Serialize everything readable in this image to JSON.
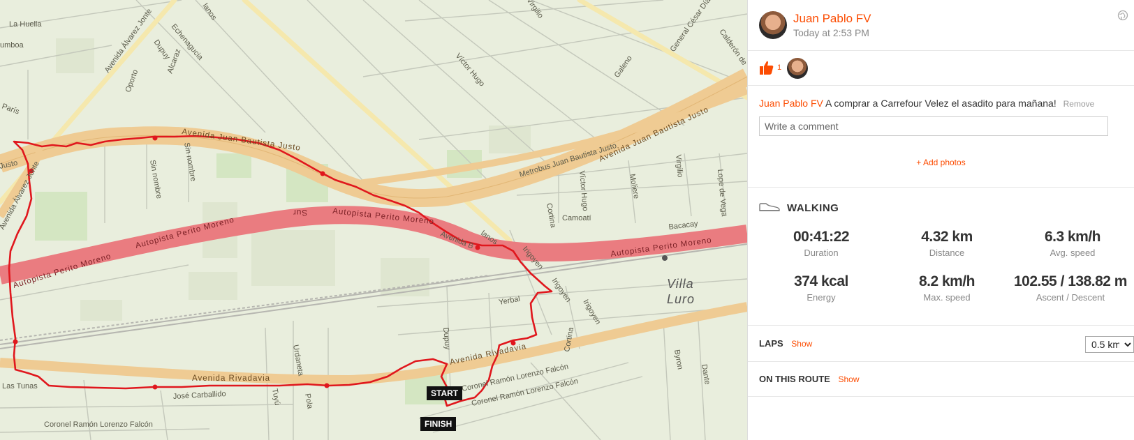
{
  "map": {
    "start_label": "START",
    "finish_label": "FINISH",
    "area_label_1": "Villa",
    "area_label_2": "Luro",
    "streets": {
      "avenida_jbj_left": "Avenida Juan Bautista Justo",
      "avenida_jbj_right": "Avenida Juan Bautista Justo",
      "metrobus": "Metrobus Juan Bautista Justo",
      "autopista_left": "Autopista Perito Moreno",
      "autopista_mid": "Autopista Perito Moreno",
      "autopista_right": "Autopista Perito Moreno",
      "avenida_rivadavia_left": "Avenida Rivadavia",
      "avenida_rivadavia_right": "Avenida Rivadavia",
      "avenida_alvarez_jonte_top": "Avenida Álvarez Jonte",
      "avenida_alvarez_jonte_left": "Avenida Álvarez Jonte",
      "justo_fragment": "Justo",
      "la_huella": "La Huella",
      "gamboa": "umboa",
      "paris": "París",
      "oporto": "Oporto",
      "dupuy_top": "Dupuy",
      "alcaraz": "Alcaraz",
      "echenagucia": "Echenagucia",
      "victor_hugo_top": "Víctor Hugo",
      "victor_hugo_mid": "Víctor Hugo",
      "galeno": "Galeno",
      "general_cesar_diaz": "General César Díaz",
      "calderon": "Calderón de",
      "sin_nombre_1": "Sin nombre",
      "sin_nombre_2": "Sin nombre",
      "cortina_top": "Cortina",
      "cortina_bottom": "Cortina",
      "camoati": "Camoatí",
      "moliere": "Moliere",
      "virgilio_right": "Virgilio",
      "lope_de_vega": "Lope de Vega",
      "bacacay": "Bacacay",
      "irigoyen_1": "Irigoyen",
      "irigoyen_2": "Irigoyen",
      "irigoyen_3": "Irigoyen",
      "avenida_b": "Avenida B",
      "lanos": "lanos",
      "yerbal": "Yerbal",
      "dupuy_bottom": "Dupuy",
      "urdaneta": "Urdaneta",
      "tuyu": "Tuyú",
      "pola": "Pola",
      "las_tunas": "Las Tunas",
      "jose_carballido": "José Carballido",
      "coronel_falcon_1": "Coronel Ramón Lorenzo Falcón",
      "coronel_falcon_2": "Coronel Ramón Lorenzo Falcón",
      "coronel_falcon_3": "Coronel Ramón Lorenzo Falcón",
      "byron": "Byron",
      "dante": "Dante",
      "virgilio_top": "Virgilio",
      "lanos_top": "lanos",
      "sur": "Sur"
    }
  },
  "activity": {
    "athlete_name": "Juan Pablo FV",
    "timestamp": "Today at 2:53 PM",
    "kudos_count": "1",
    "comment_author": "Juan Pablo FV",
    "comment_text": "A comprar a Carrefour Velez el asadito para mañana!",
    "remove_label": "Remove",
    "comment_placeholder": "Write a comment",
    "add_photos_label": "+ Add photos",
    "type": "WALKING",
    "stats": {
      "duration": {
        "value": "00:41:22",
        "label": "Duration"
      },
      "distance": {
        "value": "4.32 km",
        "label": "Distance"
      },
      "avg_speed": {
        "value": "6.3 km/h",
        "label": "Avg. speed"
      },
      "energy": {
        "value": "374 kcal",
        "label": "Energy"
      },
      "max_speed": {
        "value": "8.2 km/h",
        "label": "Max. speed"
      },
      "ascent_descent": {
        "value": "102.55 / 138.82 m",
        "label": "Ascent / Descent"
      }
    },
    "laps_title": "LAPS",
    "laps_show": "Show",
    "laps_option": "0.5 km",
    "route_title": "ON THIS ROUTE",
    "route_show": "Show"
  },
  "colors": {
    "brand": "#fc4c02",
    "route": "#e0171d",
    "highway": "#f0c98d",
    "autopista": "#ec7b7f",
    "map_bg": "#e9eedd"
  },
  "icons": {
    "kudos": "thumbs-up-icon",
    "activity": "shoe-icon",
    "privacy": "globe-icon"
  }
}
